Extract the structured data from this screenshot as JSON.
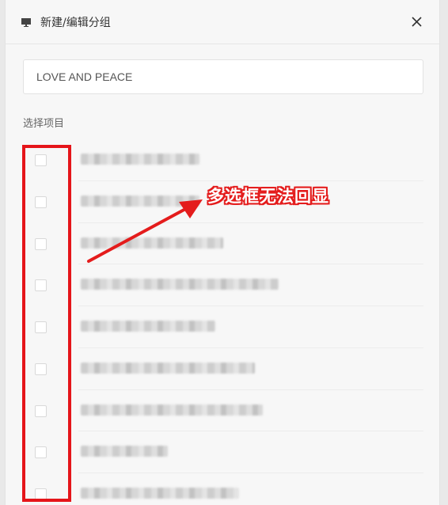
{
  "dialog": {
    "title": "新建/编辑分组",
    "close_icon": "close-icon",
    "title_icon": "monitor-icon"
  },
  "group_name": {
    "value": "LOVE AND PEACE"
  },
  "projects": {
    "label": "选择项目",
    "items_count_visible": 9,
    "item_names_blurred": true
  },
  "annotation": {
    "text": "多选框无法回显",
    "color": "#e41c1c"
  },
  "colors": {
    "highlight_box": "#e5151a",
    "background": "#f7f7f7"
  }
}
